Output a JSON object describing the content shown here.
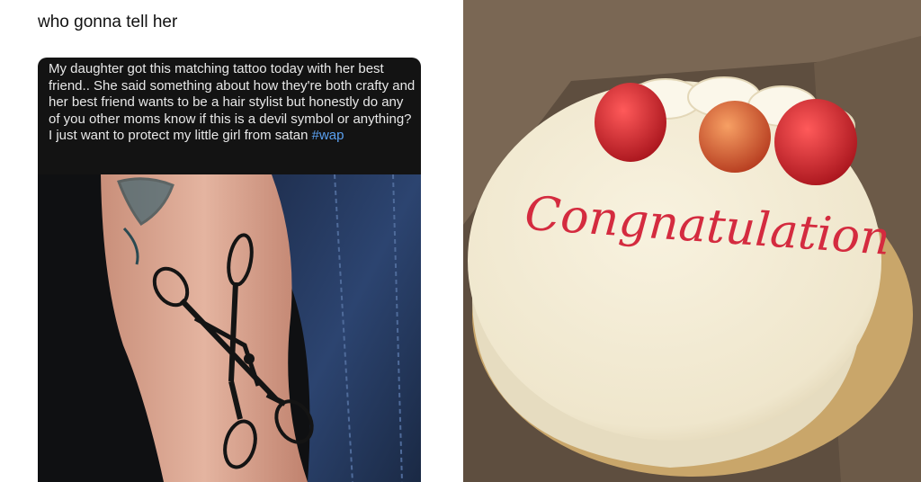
{
  "caption": "who gonna tell her",
  "post": {
    "text": "My daughter got this matching tattoo today with her best friend.. She said something about how they're both crafty and her best friend wants to be a hair stylist but honestly do any of you other moms know if this is a devil symbol or anything? I just want to protect my little girl from satan",
    "hashtag": "#wap"
  },
  "cake": {
    "inscription": "Congnatulation"
  },
  "colors": {
    "post_bg": "#131313",
    "hashtag": "#5aa0f0",
    "icing": "#d42b3f",
    "cake_frosting": "#f3ecd6",
    "box": "#6b5a49"
  },
  "icons": [
    "scissors-tattoo",
    "strawberry",
    "cake"
  ]
}
